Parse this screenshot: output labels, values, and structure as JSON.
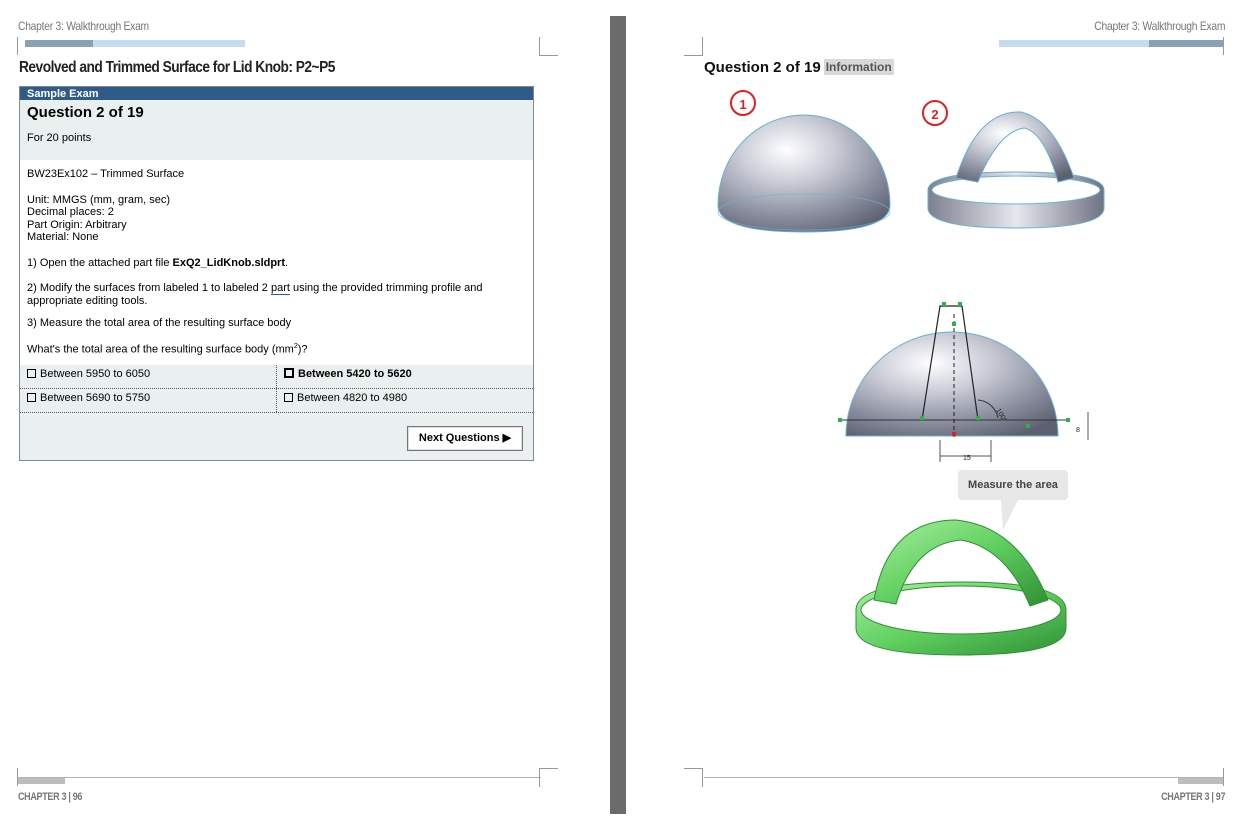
{
  "left_page": {
    "running_header": "Chapter 3: Walkthrough Exam",
    "title": "Revolved and Trimmed Surface for Lid Knob: P2~P5",
    "exam": {
      "header": "Sample Exam",
      "question": "Question 2 of 19",
      "points": "For 20 points",
      "part_name": "BW23Ex102 – Trimmed Surface",
      "unit": "Unit: MMGS (mm, gram, sec)",
      "decimals": "Decimal places: 2",
      "origin": "Part Origin: Arbitrary",
      "material": "Material: None",
      "step1_prefix": "1) Open the attached part file ",
      "step1_file": "ExQ2_LidKnob.sldprt",
      "step1_suffix": ".",
      "step2_prefix": "2) Modify the surfaces from labeled 1 to labeled 2 ",
      "step2_link": "part",
      "step2_suffix": " using the provided trimming profile and appropriate editing tools.",
      "step3": "3) Measure the total area of the resulting surface body",
      "prompt_prefix": "What's the total area of the resulting surface body (mm",
      "prompt_sup": "2",
      "prompt_suffix": ")?",
      "options": [
        {
          "label": "Between 5950 to 6050",
          "selected": false
        },
        {
          "label": "Between 5420 to 5620",
          "selected": true
        },
        {
          "label": "Between 5690 to 5750",
          "selected": false
        },
        {
          "label": "Between 4820 to 4980",
          "selected": false
        }
      ],
      "next_button": "Next Questions ▶"
    },
    "footer": "CHAPTER 3 | 96"
  },
  "right_page": {
    "running_header": "Chapter 3: Walkthrough Exam",
    "question": "Question 2 of 19",
    "info_tag": "Information",
    "marker_1": "1",
    "marker_2": "2",
    "sketch": {
      "angle": "100°",
      "height": "8",
      "width": "15"
    },
    "callout": "Measure the area",
    "footer": "CHAPTER 3 | 97"
  },
  "colors": {
    "header_blue": "#2e5b88",
    "panel_bg": "#eaf0ef",
    "marker_red": "#e02020",
    "result_green": "#5fcf5f",
    "bar_light": "#c5dbee",
    "bar_dark": "#8aa1b5"
  }
}
